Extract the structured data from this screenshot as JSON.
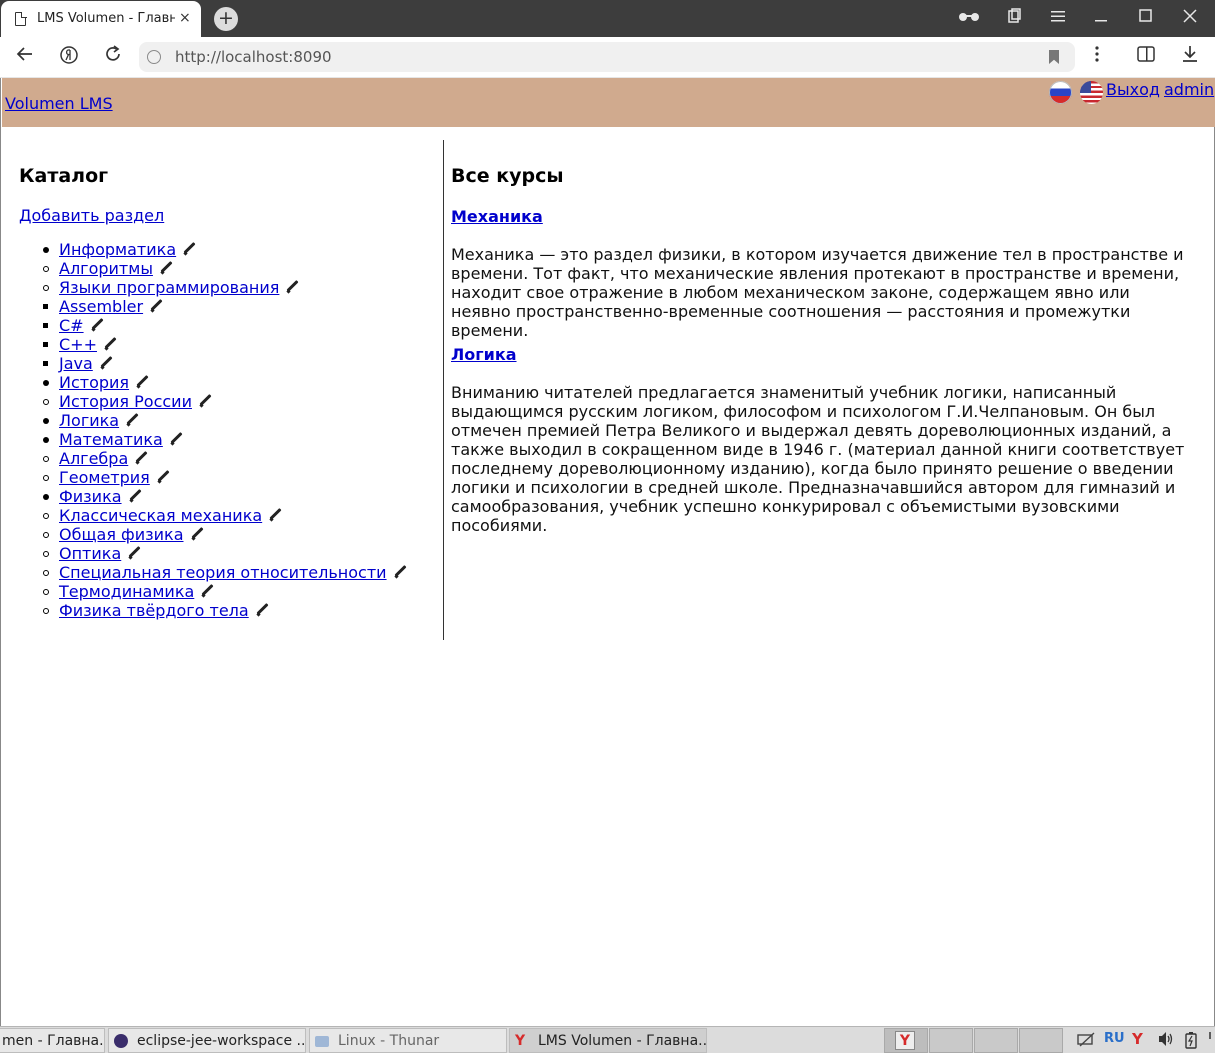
{
  "browser": {
    "tab_title": "LMS Volumen - Главная",
    "tab_close": "×",
    "new_tab": "+",
    "url_host": "http://localhost",
    "url_port": ":8090"
  },
  "header": {
    "brand": "Volumen LMS",
    "logout": "Выход",
    "user": "admin"
  },
  "catalog": {
    "title": "Каталог",
    "add_section": "Добавить раздел",
    "tree": [
      {
        "label": "Информатика",
        "children": [
          {
            "label": "Алгоритмы"
          },
          {
            "label": "Языки программирования",
            "children": [
              {
                "label": "Assembler"
              },
              {
                "label": "C#"
              },
              {
                "label": "C++"
              },
              {
                "label": "Java"
              }
            ]
          }
        ]
      },
      {
        "label": "История",
        "children": [
          {
            "label": "История России"
          }
        ]
      },
      {
        "label": "Логика"
      },
      {
        "label": "Математика",
        "children": [
          {
            "label": "Алгебра"
          },
          {
            "label": "Геометрия"
          }
        ]
      },
      {
        "label": "Физика",
        "children": [
          {
            "label": "Классическая механика"
          },
          {
            "label": "Общая физика"
          },
          {
            "label": "Оптика"
          },
          {
            "label": "Специальная теория относительности"
          },
          {
            "label": "Термодинамика"
          },
          {
            "label": "Физика твёрдого тела"
          }
        ]
      }
    ]
  },
  "courses": {
    "title": "Все курсы",
    "items": [
      {
        "title": "Механика",
        "description": "Механика — это раздел физики, в котором изучается движение тел в пространстве и времени. Тот факт, что механические явления протекают в пространстве и времени, находит свое отражение в любом механическом законе, содержащем явно или неявно пространственно-временные соотношения — расстояния и промежутки времени."
      },
      {
        "title": "Логика",
        "description": "Вниманию читателей предлагается знаменитый учебник логики, написанный выдающимся русским логиком, философом и психологом Г.И.Челпановым. Он был отмечен премией Петра Великого и выдержал девять дореволюционных изданий, а также выходил в сокращенном виде в 1946 г. (материал данной книги соответствует последнему дореволюционному изданию), когда было принято решение о введении логики и психологии в средней школе. Предназначавшийся автором для гимназий и самообразования, учебник успешно конкурировал с объемистыми вузовскими пособиями."
      }
    ]
  },
  "taskbar": {
    "tasks": [
      "men - Главна...",
      "eclipse-jee-workspace ...",
      "Linux - Thunar",
      "LMS Volumen - Главна..."
    ],
    "lang": "RU"
  }
}
